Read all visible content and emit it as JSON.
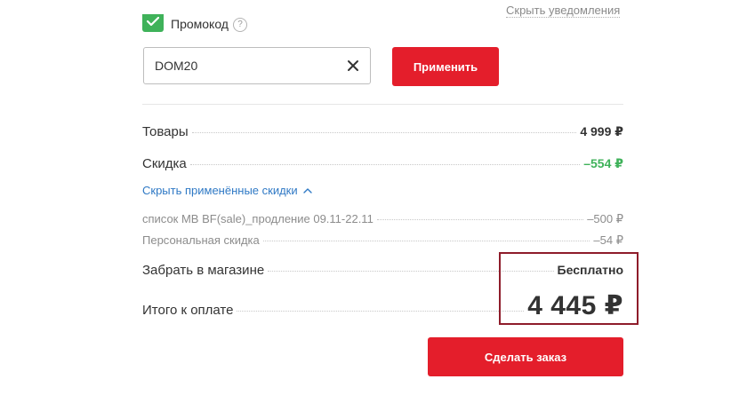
{
  "notifications": {
    "hide_label": "Скрыть уведомления"
  },
  "promo": {
    "label": "Промокод",
    "help_glyph": "?",
    "code_value": "DOM20",
    "apply_label": "Применить"
  },
  "summary": {
    "goods_label": "Товары",
    "goods_value": "4 999 ₽",
    "discount_label": "Скидка",
    "discount_value": "–554 ₽",
    "toggle_discounts_label": "Скрыть применённые скидки",
    "discounts": [
      {
        "label": "список MB BF(sale)_продление 09.11-22.11",
        "value": "–500 ₽"
      },
      {
        "label": "Персональная скидка",
        "value": "–54 ₽"
      }
    ],
    "pickup_label": "Забрать в магазине",
    "pickup_value": "Бесплатно",
    "total_label": "Итого к оплате",
    "total_value": "4 445 ₽"
  },
  "order_button_label": "Сделать заказ",
  "colors": {
    "accent_red": "#e41e2b",
    "discount_green": "#3fb25a",
    "link_blue": "#2f79c5",
    "highlight_border": "#8e1c2a"
  },
  "icons": {
    "checkbox": "check-icon",
    "clear": "close-icon",
    "toggle": "chevron-up-icon",
    "help": "question-icon"
  }
}
